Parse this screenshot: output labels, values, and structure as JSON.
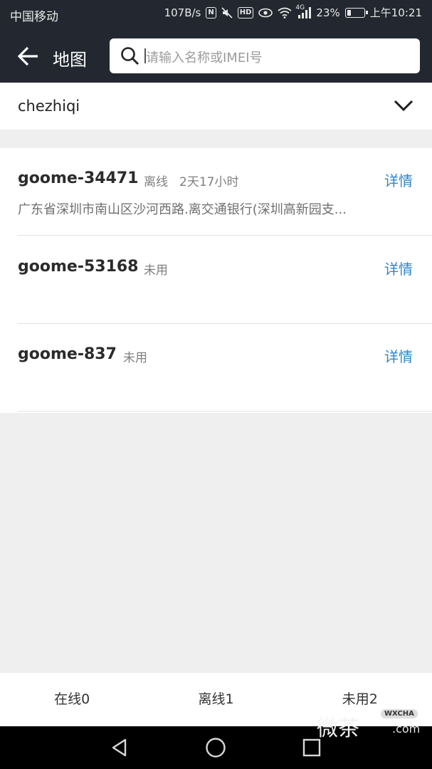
{
  "status_bar": {
    "carrier": "中国移动",
    "net_speed": "107B/s",
    "nfc": "N",
    "hd": "HD",
    "signal_tag": "4G",
    "battery": "23%",
    "battery_level": 0.23,
    "time": "上午10:21"
  },
  "header": {
    "title": "地图",
    "search_placeholder": "请输入名称或IMEI号"
  },
  "filter": {
    "selected": "chezhiqi"
  },
  "devices": [
    {
      "name": "goome-34471",
      "status": "离线",
      "duration": "2天17小时",
      "detail": "详情",
      "address": "广东省深圳市南山区沙河西路.离交通银行(深圳高新园支..."
    },
    {
      "name": "goome-53168",
      "status": "未用",
      "duration": "",
      "detail": "详情",
      "address": ""
    },
    {
      "name": "goome-837",
      "status": "未用",
      "duration": "",
      "detail": "详情",
      "address": ""
    }
  ],
  "tabs": [
    {
      "label": "在线0"
    },
    {
      "label": "离线1"
    },
    {
      "label": "未用2"
    }
  ],
  "watermark": {
    "text": "微茶",
    "badge": "WXCHA",
    "domain": ".com"
  },
  "colors": {
    "header_bg": "#232830",
    "link": "#2f86c9",
    "page_bg": "#efefef"
  }
}
